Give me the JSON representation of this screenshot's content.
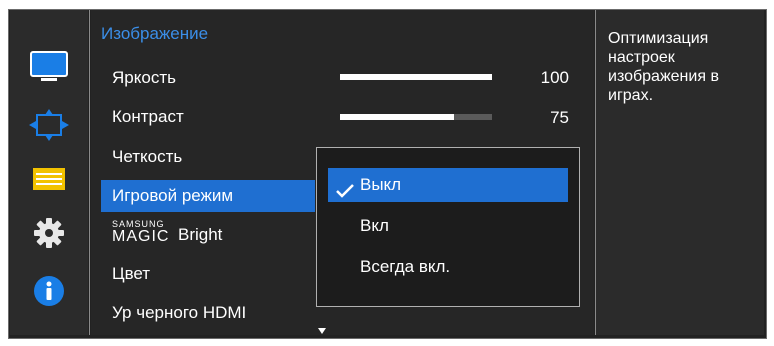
{
  "sidebar": {
    "icons": [
      "monitor-icon",
      "screen-resize-icon",
      "menu-list-icon",
      "gear-icon",
      "info-icon"
    ]
  },
  "menu": {
    "title": "Изображение",
    "items": [
      {
        "label": "Яркость",
        "value": "100",
        "level": 1.0
      },
      {
        "label": "Контраст",
        "value": "75",
        "level": 0.75
      },
      {
        "label": "Четкость"
      },
      {
        "label": "Игровой режим",
        "selected": true
      },
      {
        "label_brand_top": "SAMSUNG",
        "label_brand_bottom": "MAGIC",
        "label": "Bright"
      },
      {
        "label": "Цвет"
      },
      {
        "label": "Ур черного HDMI"
      }
    ]
  },
  "dropdown": {
    "options": [
      {
        "label": "Выкл",
        "selected": true
      },
      {
        "label": "Вкл"
      },
      {
        "label": "Всегда вкл."
      }
    ]
  },
  "help": {
    "text": "Оптимизация настроек изображения в играх."
  },
  "colors": {
    "accent": "#1f6fd1",
    "title": "#3b8ee8",
    "background": "#222222"
  }
}
